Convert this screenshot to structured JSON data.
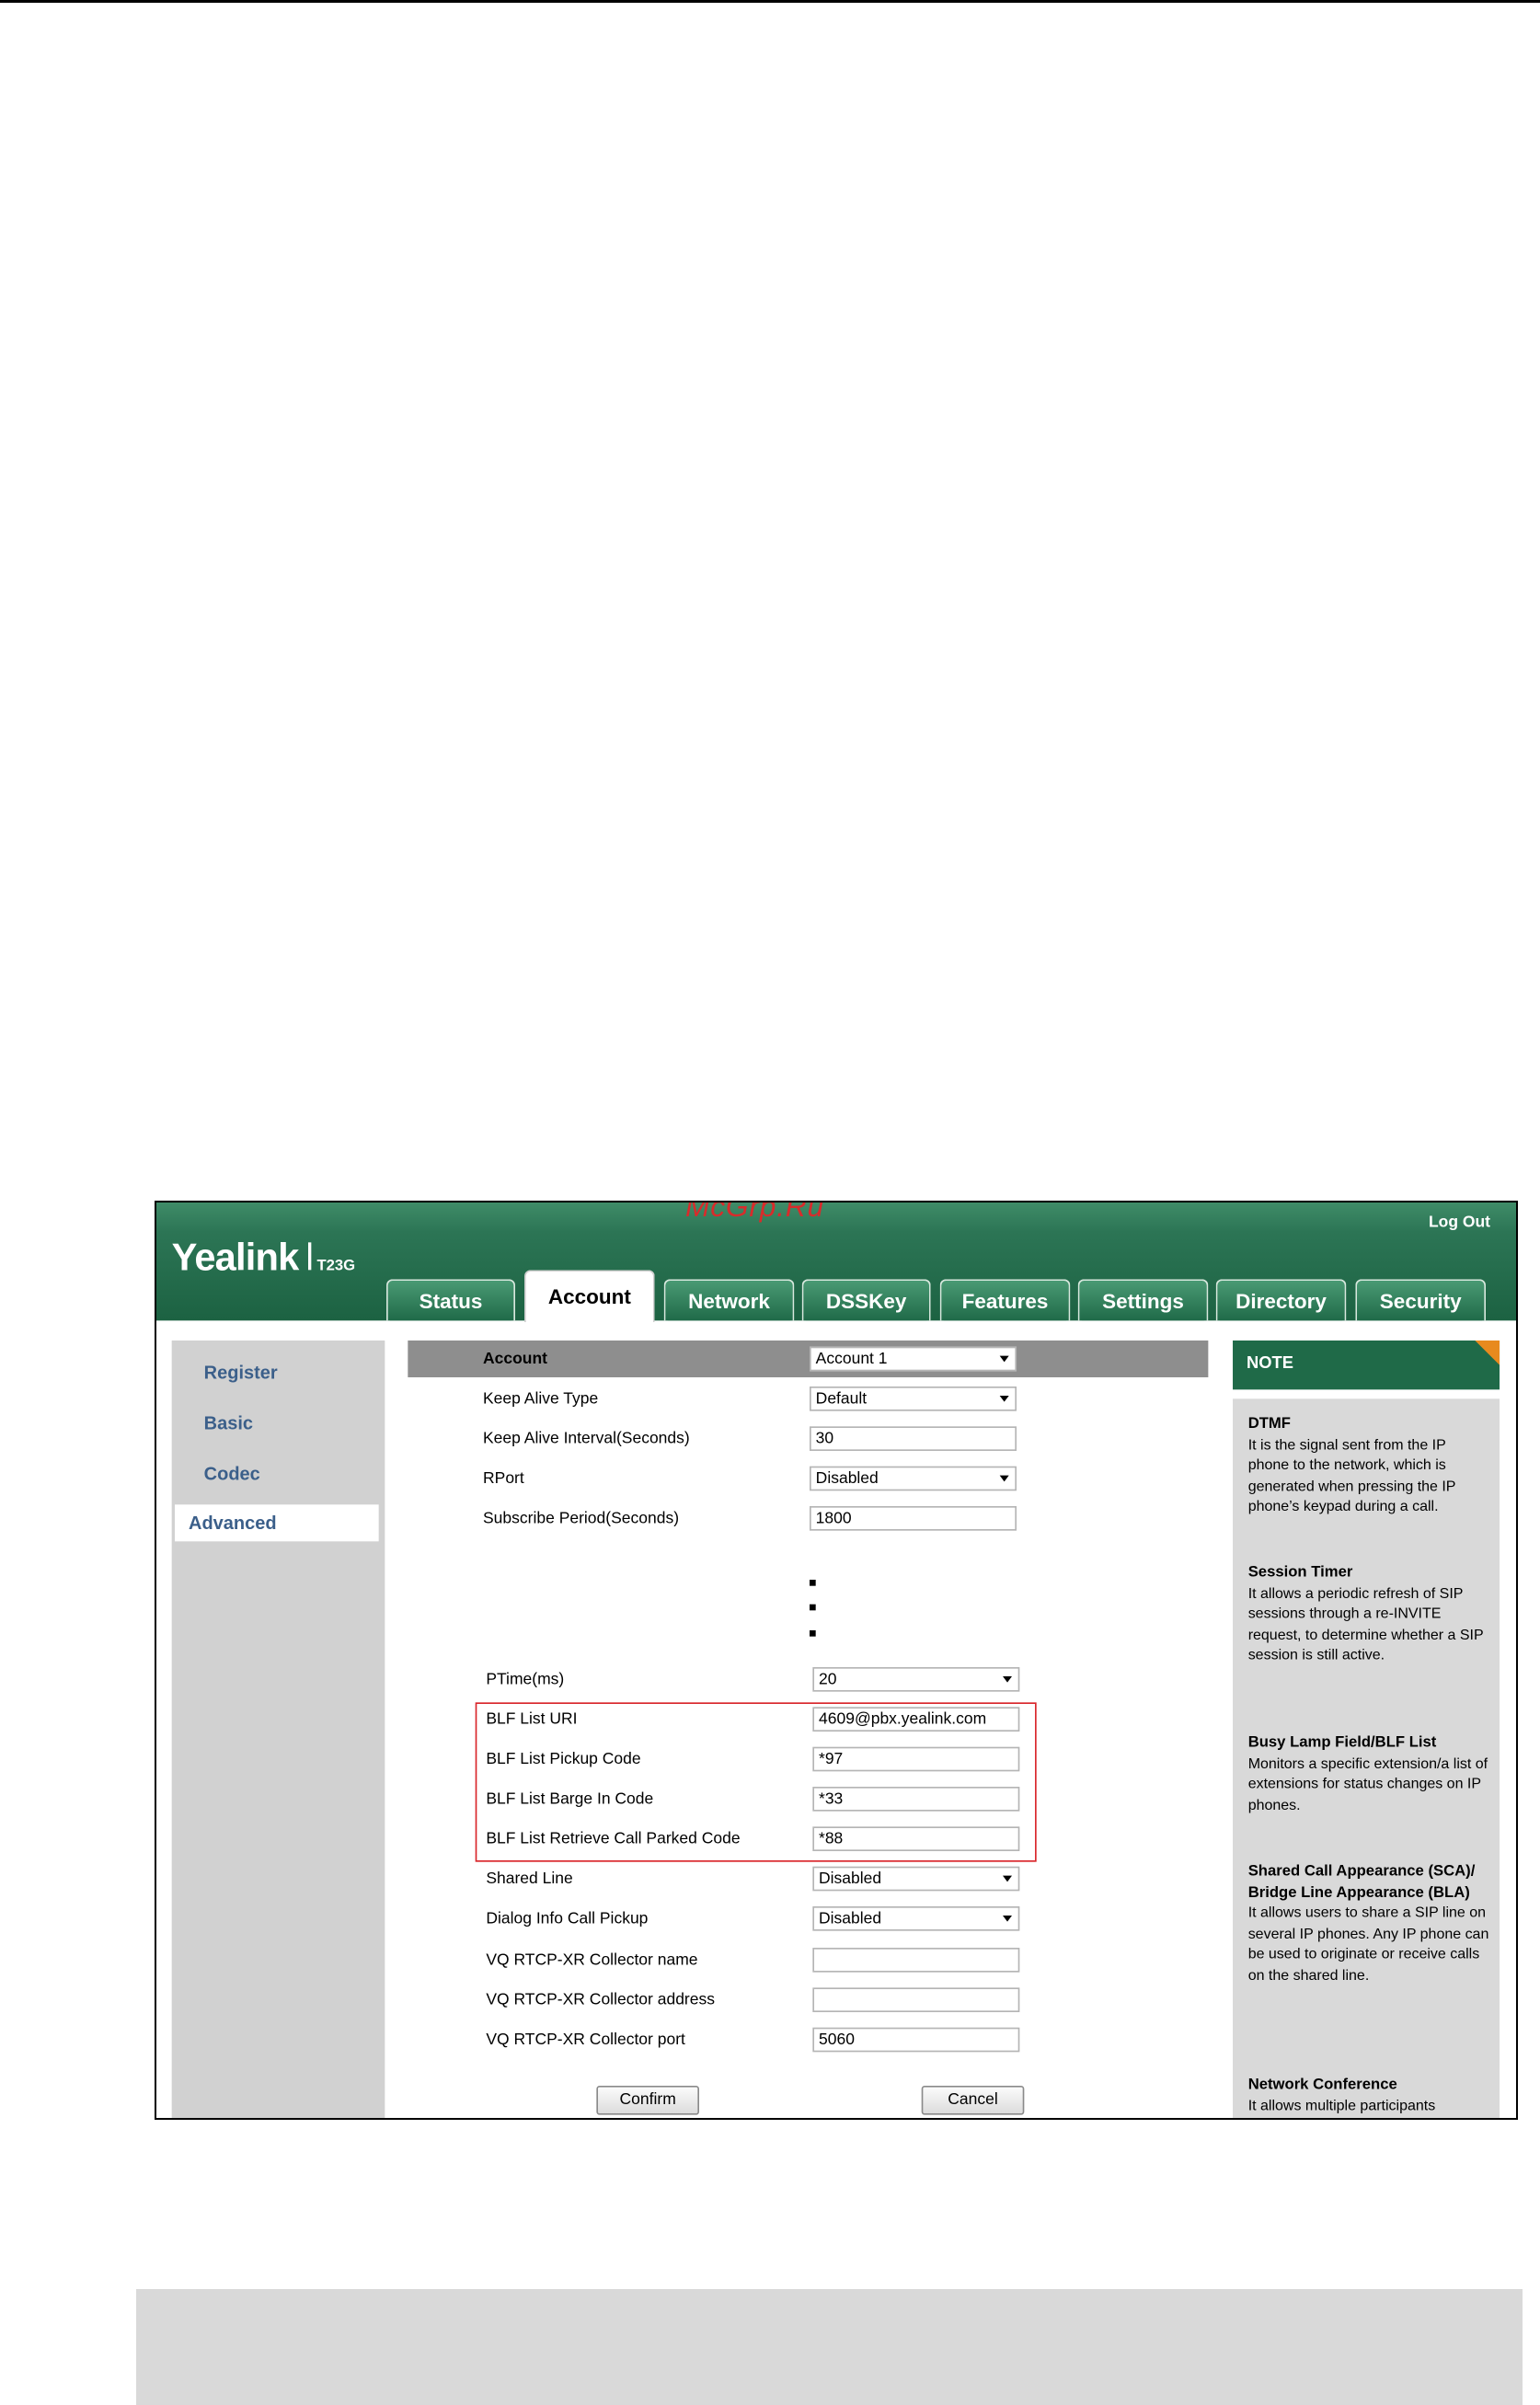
{
  "watermark": "McGrp.Ru",
  "header": {
    "logo": "Yealink",
    "model": "T23G",
    "logout": "Log Out"
  },
  "tabs": [
    {
      "label": "Status",
      "active": false
    },
    {
      "label": "Account",
      "active": true
    },
    {
      "label": "Network",
      "active": false
    },
    {
      "label": "DSSKey",
      "active": false
    },
    {
      "label": "Features",
      "active": false
    },
    {
      "label": "Settings",
      "active": false
    },
    {
      "label": "Directory",
      "active": false
    },
    {
      "label": "Security",
      "active": false
    }
  ],
  "sidebar": {
    "items": [
      "Register",
      "Basic",
      "Codec",
      "Advanced"
    ],
    "active": "Advanced"
  },
  "form": {
    "account_label": "Account",
    "account_value": "Account 1",
    "rows": {
      "keep_alive_type": {
        "label": "Keep Alive Type",
        "value": "Default"
      },
      "keep_alive_interval": {
        "label": "Keep Alive Interval(Seconds)",
        "value": "30"
      },
      "rport": {
        "label": "RPort",
        "value": "Disabled"
      },
      "subscribe_period": {
        "label": "Subscribe Period(Seconds)",
        "value": "1800"
      },
      "ptime": {
        "label": "PTime(ms)",
        "value": "20"
      },
      "blf_list_uri": {
        "label": "BLF List URI",
        "value": "4609@pbx.yealink.com"
      },
      "blf_pickup": {
        "label": "BLF List Pickup Code",
        "value": "*97"
      },
      "blf_barge": {
        "label": "BLF List Barge In Code",
        "value": "*33"
      },
      "blf_retrieve": {
        "label": "BLF List Retrieve Call Parked Code",
        "value": "*88"
      },
      "shared_line": {
        "label": "Shared Line",
        "value": "Disabled"
      },
      "dialog_info": {
        "label": "Dialog Info Call Pickup",
        "value": "Disabled"
      },
      "vq_name": {
        "label": "VQ RTCP-XR Collector name",
        "value": ""
      },
      "vq_address": {
        "label": "VQ RTCP-XR Collector address",
        "value": ""
      },
      "vq_port": {
        "label": "VQ RTCP-XR Collector port",
        "value": "5060"
      }
    },
    "confirm": "Confirm",
    "cancel": "Cancel"
  },
  "note": {
    "title": "NOTE",
    "sections": [
      {
        "title": "DTMF",
        "text": "It is the signal sent from the IP phone to the network, which is generated when pressing the IP phone’s keypad during a call."
      },
      {
        "title": "Session Timer",
        "text": "It allows a periodic refresh of SIP sessions through a re-INVITE request, to determine whether a SIP session is still active."
      },
      {
        "title": "Busy Lamp Field/BLF List",
        "text": "Monitors a specific extension/a list of extensions for status changes on IP phones."
      },
      {
        "title": "Shared Call Appearance (SCA)/ Bridge Line Appearance (BLA)",
        "text": "It allows users to share a SIP line on several IP phones. Any IP phone can be used to originate or receive calls on the shared line."
      },
      {
        "title": "Network Conference",
        "text": "It allows multiple participants"
      }
    ]
  }
}
